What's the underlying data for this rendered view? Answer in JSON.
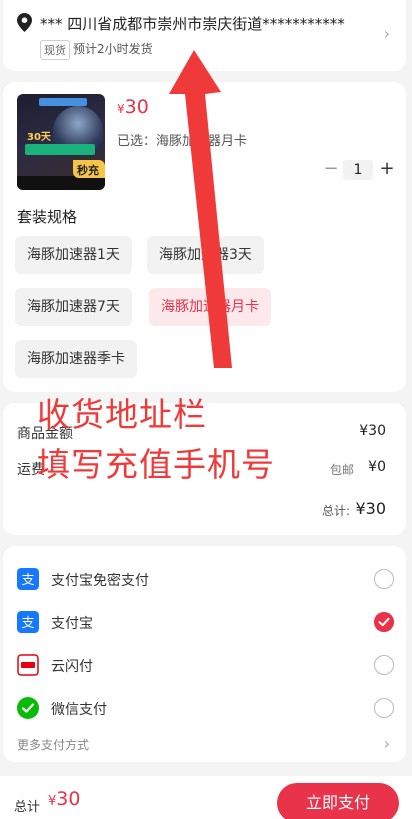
{
  "address": {
    "text": "*** 四川省成都市崇州市崇庆街道***********",
    "stock_tag": "现货",
    "eta": "预计2小时发货",
    "icon": "location-pin-icon",
    "chevron": "›"
  },
  "product": {
    "thumb_badge_30": "30天",
    "seckill": "秒充",
    "price_symbol": "¥",
    "price": "30",
    "selected": "已选：海豚加速器月卡",
    "quantity": "1",
    "minus": "−",
    "plus": "+",
    "spec_title": "套装规格",
    "options": [
      "海豚加速器1天",
      "海豚加速器3天",
      "海豚加速器7天",
      "海豚加速器月卡",
      "海豚加速器季卡"
    ],
    "active_option": "海豚加速器月卡"
  },
  "summary": {
    "goods_label": "商品金额",
    "goods_value": "¥30",
    "shipping_label": "运费",
    "shipping_free": "包邮",
    "shipping_value": "¥0",
    "total_label": "总计:",
    "total_value": "¥30"
  },
  "payment": {
    "methods": [
      {
        "label": "支付宝免密支付",
        "icon": "alipay-icon",
        "selected": false
      },
      {
        "label": "支付宝",
        "icon": "alipay-icon",
        "selected": true
      },
      {
        "label": "云闪付",
        "icon": "unionpay-icon",
        "selected": false
      },
      {
        "label": "微信支付",
        "icon": "wechat-pay-icon",
        "selected": false
      }
    ],
    "more": "更多支付方式",
    "chevron": "›"
  },
  "bottom": {
    "total_label": "总计",
    "price_symbol": "¥",
    "price": "30",
    "pay_button": "立即支付"
  },
  "annotation": {
    "line1": "收货地址栏",
    "line2": "填写充值手机号"
  },
  "colors": {
    "accent": "#e8334a",
    "annotation": "#f03a3a",
    "alipay": "#1677ff",
    "wechat": "#09bb07",
    "unionpay": "#e60012"
  }
}
